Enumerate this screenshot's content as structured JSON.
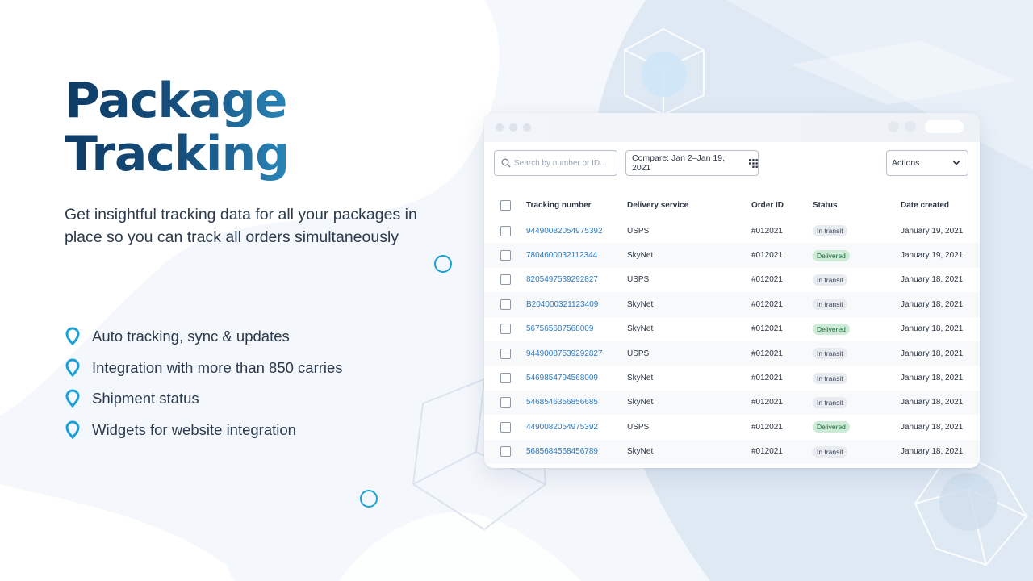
{
  "hero": {
    "title_line1": "Package",
    "title_line2": "Tracking",
    "subtitle": "Get insightful tracking data for all your packages in place so you can track all orders simultaneously"
  },
  "features": [
    {
      "icon": "location-pin-icon",
      "label": "Auto tracking, sync & updates"
    },
    {
      "icon": "location-pin-icon",
      "label": "Integration with more than 850 carries"
    },
    {
      "icon": "location-pin-icon",
      "label": "Shipment status"
    },
    {
      "icon": "location-pin-icon",
      "label": "Widgets for website integration"
    }
  ],
  "colors": {
    "accent": "#1aa0d4",
    "title_dark": "#0f3b66",
    "link": "#2f7bc1",
    "delivered_bg": "#cdebd7",
    "transit_bg": "#e8ebef"
  },
  "app": {
    "search": {
      "placeholder": "Search by number or ID...",
      "icon": "search-icon"
    },
    "compare_label": "Compare: Jan 2–Jan 19, 2021",
    "compare_icon": "calendar-grid-icon",
    "actions_label": "Actions",
    "actions_icon": "chevron-down-icon",
    "columns": [
      "Tracking number",
      "Delivery service",
      "Order ID",
      "Status",
      "Date created"
    ],
    "rows": [
      {
        "tracking": "94490082054975392",
        "service": "USPS",
        "order": "#012021",
        "status": "In transit",
        "date": "January 19, 2021"
      },
      {
        "tracking": "7804600032112344",
        "service": "SkyNet",
        "order": "#012021",
        "status": "Delivered",
        "date": "January 19, 2021"
      },
      {
        "tracking": "8205497539292827",
        "service": "USPS",
        "order": "#012021",
        "status": "In transit",
        "date": "January 18, 2021"
      },
      {
        "tracking": "B204000321123409",
        "service": "SkyNet",
        "order": "#012021",
        "status": "In transit",
        "date": "January 18, 2021"
      },
      {
        "tracking": "567565687568009",
        "service": "SkyNet",
        "order": "#012021",
        "status": "Delivered",
        "date": "January 18, 2021"
      },
      {
        "tracking": "94490087539292827",
        "service": "USPS",
        "order": "#012021",
        "status": "In transit",
        "date": "January 18, 2021"
      },
      {
        "tracking": "5469854794568009",
        "service": "SkyNet",
        "order": "#012021",
        "status": "In transit",
        "date": "January 18, 2021"
      },
      {
        "tracking": "5468546356856685",
        "service": "SkyNet",
        "order": "#012021",
        "status": "In transit",
        "date": "January 18, 2021"
      },
      {
        "tracking": "4490082054975392",
        "service": "USPS",
        "order": "#012021",
        "status": "Delivered",
        "date": "January 18, 2021"
      },
      {
        "tracking": "5685684568456789",
        "service": "SkyNet",
        "order": "#012021",
        "status": "In transit",
        "date": "January 18, 2021"
      }
    ]
  }
}
